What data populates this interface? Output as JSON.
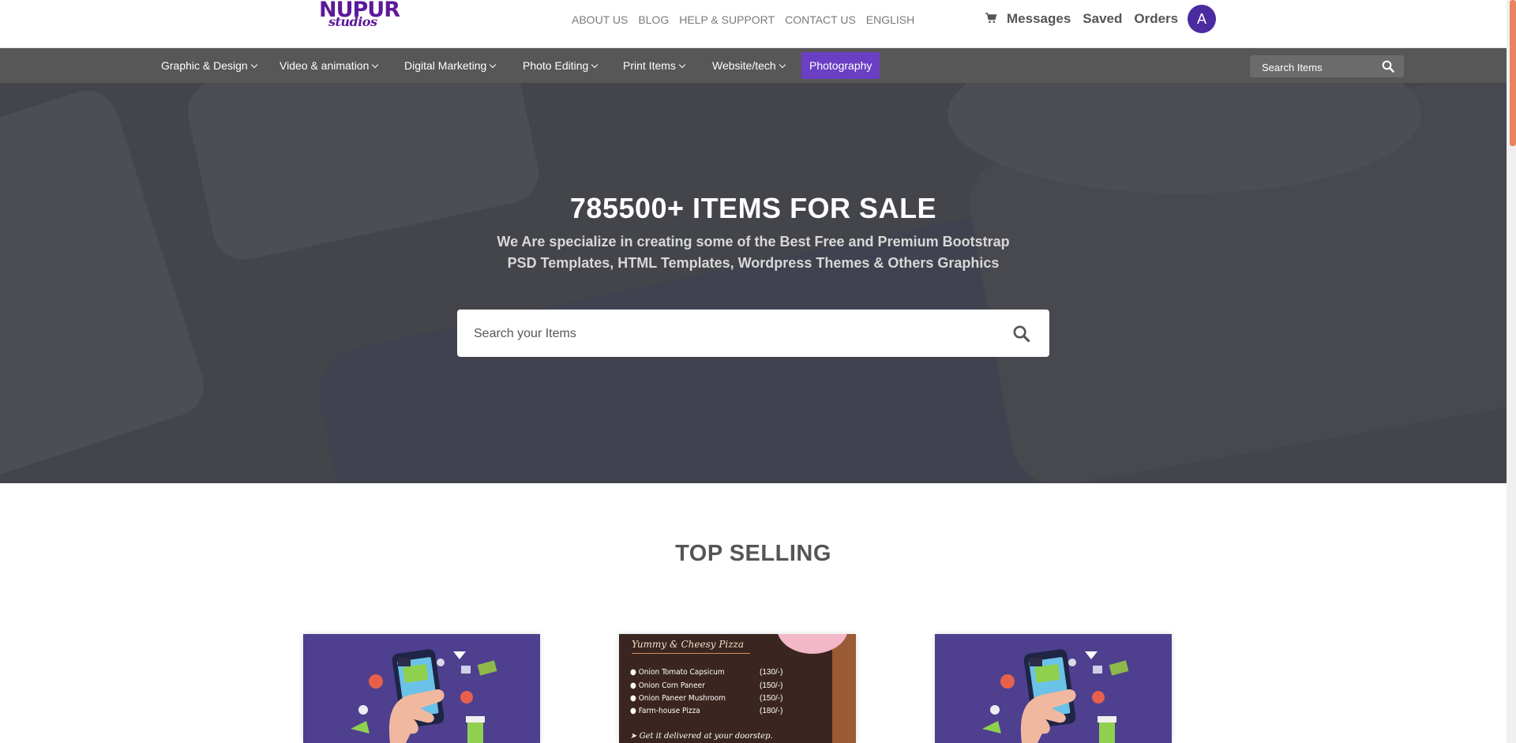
{
  "header": {
    "logo": {
      "line1": "NUPUR",
      "line2": "studios"
    },
    "top_links": [
      "ABOUT US",
      "BLOG",
      "HELP & SUPPORT",
      "CONTACT US",
      "ENGLISH"
    ],
    "user_links": [
      "Messages",
      "Saved",
      "Orders"
    ],
    "avatar_letter": "A"
  },
  "categories": [
    {
      "label": "Graphic & Design",
      "dropdown": true
    },
    {
      "label": "Video & animation",
      "dropdown": true
    },
    {
      "label": "Digital Marketing",
      "dropdown": true
    },
    {
      "label": "Photo Editing",
      "dropdown": true
    },
    {
      "label": "Print Items",
      "dropdown": true
    },
    {
      "label": "Website/tech",
      "dropdown": true
    },
    {
      "label": "Photography",
      "dropdown": false,
      "active": true
    }
  ],
  "nav_search": {
    "placeholder": "Search Items"
  },
  "hero": {
    "title": "785500+ ITEMS FOR SALE",
    "subtitle": "We Are specialize in creating some of the Best Free and Premium Bootstrap PSD Templates, HTML Templates, Wordpress Themes & Others Graphics",
    "search_placeholder": "Search your Items"
  },
  "top_selling": {
    "title": "TOP SELLING",
    "menu_card": {
      "heading": "Yummy & Cheesy Pizza",
      "items": [
        {
          "name": "Onion Tomato Capsicum",
          "price": "(130/-)"
        },
        {
          "name": "Onion Corn Paneer",
          "price": "(150/-)"
        },
        {
          "name": "Onion Paneer Mushroom",
          "price": "(150/-)"
        },
        {
          "name": "Farm-house Pizza",
          "price": "(180/-)"
        }
      ],
      "footer": "Get it delivered at your doorstep."
    }
  },
  "colors": {
    "brand": "#5b1a9b",
    "nav_bg": "#575757",
    "active_category": "#6b3fc4",
    "avatar": "#4b2ba0",
    "scroll_thumb": "#e8845e"
  },
  "icons": {
    "cart": "shopping-cart-icon",
    "search": "search-icon",
    "dropdown": "chevron-down-icon"
  }
}
